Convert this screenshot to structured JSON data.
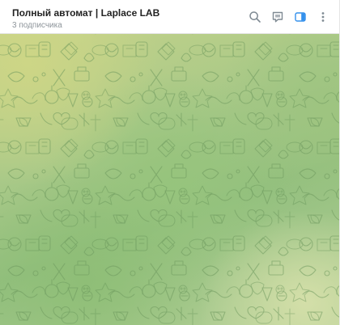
{
  "header": {
    "title": "Полный автомат | Laplace LAB",
    "subtitle": "3 подписчика"
  },
  "actions": {
    "search_icon": "search-icon",
    "discuss_icon": "comments-icon",
    "sidebar_icon": "sidebar-toggle-icon",
    "more_icon": "more-vertical-icon"
  },
  "colors": {
    "icon": "#7f8a93",
    "sidebar_icon_active": "#3390ec",
    "title": "#222222",
    "subtitle": "#8e959b"
  }
}
